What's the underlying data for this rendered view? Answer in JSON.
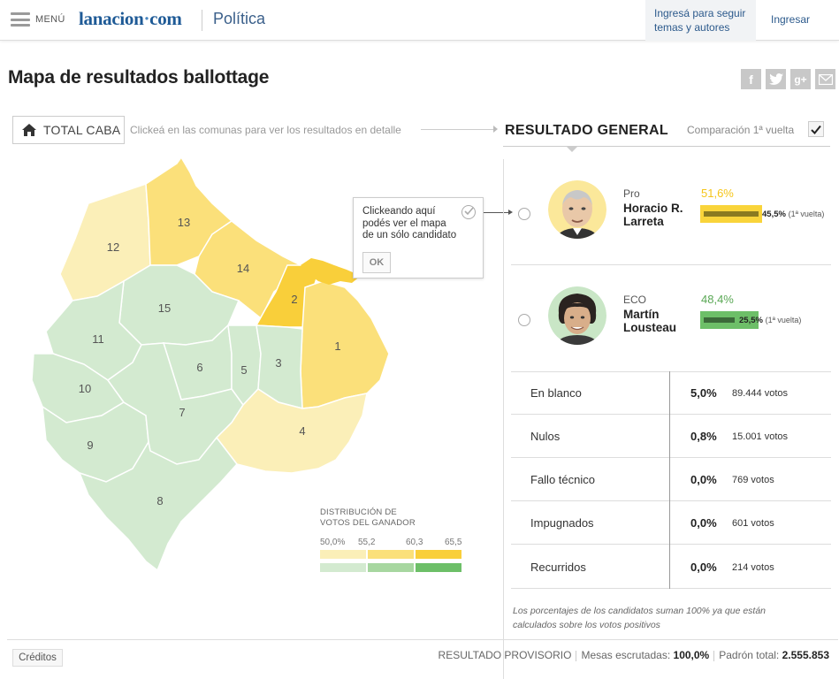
{
  "header": {
    "menu_label": "MENÚ",
    "logo_main": "lanacion",
    "logo_dot": "·",
    "logo_tld": "com",
    "section": "Política",
    "follow_text": "Ingresá para seguir temas y autores",
    "login": "Ingresar"
  },
  "page": {
    "title": "Mapa de resultados ballottage",
    "share_icons": [
      "facebook-icon",
      "twitter-icon",
      "google-plus-icon",
      "mail-icon"
    ]
  },
  "map_controls": {
    "total_button": "TOTAL CABA",
    "hint": "Clickeá en las comunas para ver los resultados en detalle"
  },
  "map": {
    "comunas": [
      {
        "id": "1",
        "label": "1",
        "winner": "Pro",
        "color": "#fbe07a"
      },
      {
        "id": "2",
        "label": "2",
        "winner": "Pro",
        "color": "#f9cf3a"
      },
      {
        "id": "3",
        "label": "3",
        "winner": "ECO",
        "color": "#d3ead0"
      },
      {
        "id": "4",
        "label": "4",
        "winner": "Pro",
        "color": "#fbefb8"
      },
      {
        "id": "5",
        "label": "5",
        "winner": "ECO",
        "color": "#d3ead0"
      },
      {
        "id": "6",
        "label": "6",
        "winner": "ECO",
        "color": "#d3ead0"
      },
      {
        "id": "7",
        "label": "7",
        "winner": "ECO",
        "color": "#d3ead0"
      },
      {
        "id": "8",
        "label": "8",
        "winner": "ECO",
        "color": "#d3ead0"
      },
      {
        "id": "9",
        "label": "9",
        "winner": "ECO",
        "color": "#d3ead0"
      },
      {
        "id": "10",
        "label": "10",
        "winner": "ECO",
        "color": "#d3ead0"
      },
      {
        "id": "11",
        "label": "11",
        "winner": "ECO",
        "color": "#d3ead0"
      },
      {
        "id": "12",
        "label": "12",
        "winner": "Pro",
        "color": "#fbefb8"
      },
      {
        "id": "13",
        "label": "13",
        "winner": "Pro",
        "color": "#fbe07a"
      },
      {
        "id": "14",
        "label": "14",
        "winner": "Pro",
        "color": "#fbe07a"
      },
      {
        "id": "15",
        "label": "15",
        "winner": "ECO",
        "color": "#d3ead0"
      }
    ],
    "water_color": "#f9cf3a"
  },
  "tooltip": {
    "text": "Clickeando aquí podés ver el mapa de un sólo candidato",
    "ok": "OK"
  },
  "legend": {
    "title_line1": "DISTRIBUCIÓN DE",
    "title_line2": "VOTOS DEL GANADOR",
    "values": [
      "50,0%",
      "55,2",
      "60,3",
      "65,5"
    ],
    "yellow_colors": [
      "#fbefb8",
      "#fbe07a",
      "#f9cf3a"
    ],
    "green_colors": [
      "#d3ead0",
      "#a7d7a0",
      "#6dbf68"
    ]
  },
  "results": {
    "title": "RESULTADO GENERAL",
    "comparison_label": "Comparación 1ª vuelta",
    "candidates": [
      {
        "party": "Pro",
        "name_line1": "Horacio R.",
        "name_line2": "Larreta",
        "pct": "51,6%",
        "pct_value": 51.6,
        "first_round": "45,5%",
        "first_round_value": 45.5,
        "first_round_note": "(1ª vuelta)",
        "color": "#f5c518",
        "bar_color": "#f9d43a",
        "inner_color": "#8a7a20",
        "avatar_bg": "#fbe89a"
      },
      {
        "party": "ECO",
        "name_line1": "Martín",
        "name_line2": "Lousteau",
        "pct": "48,4%",
        "pct_value": 48.4,
        "first_round": "25,5%",
        "first_round_value": 25.5,
        "first_round_note": "(1ª vuelta)",
        "color": "#5aa855",
        "bar_color": "#6dbf68",
        "inner_color": "#3c6a3a",
        "avatar_bg": "#c9e6c6"
      }
    ],
    "stats": [
      {
        "label": "En blanco",
        "pct": "5,0%",
        "votes": "89.444 votos"
      },
      {
        "label": "Nulos",
        "pct": "0,8%",
        "votes": "15.001 votos"
      },
      {
        "label": "Fallo técnico",
        "pct": "0,0%",
        "votes": "769 votos"
      },
      {
        "label": "Impugnados",
        "pct": "0,0%",
        "votes": "601 votos"
      },
      {
        "label": "Recurridos",
        "pct": "0,0%",
        "votes": "214 votos"
      }
    ],
    "note": "Los porcentajes de los candidatos suman 100% ya que están calculados sobre los votos positivos"
  },
  "footer": {
    "credits": "Créditos",
    "provisional": "RESULTADO PROVISORIO",
    "mesas_label": "Mesas escrutadas:",
    "mesas_value": "100,0%",
    "padron_label": "Padrón total:",
    "padron_value": "2.555.853"
  }
}
